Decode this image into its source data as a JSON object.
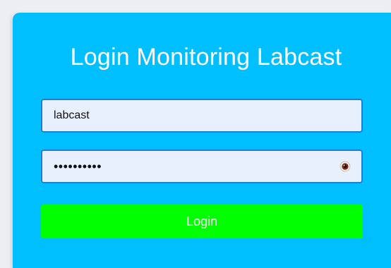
{
  "login": {
    "title": "Login Monitoring Labcast",
    "username_value": "labcast",
    "password_value": "labcast123",
    "button_label": "Login"
  },
  "colors": {
    "page_background": "#eceef1",
    "card_background": "#00bfff",
    "input_background": "#e8f0fe",
    "input_border": "#1e7fd0",
    "button_background": "#00ff00",
    "text_light": "#ffffff"
  },
  "icons": {
    "password_toggle": "eye-icon"
  }
}
